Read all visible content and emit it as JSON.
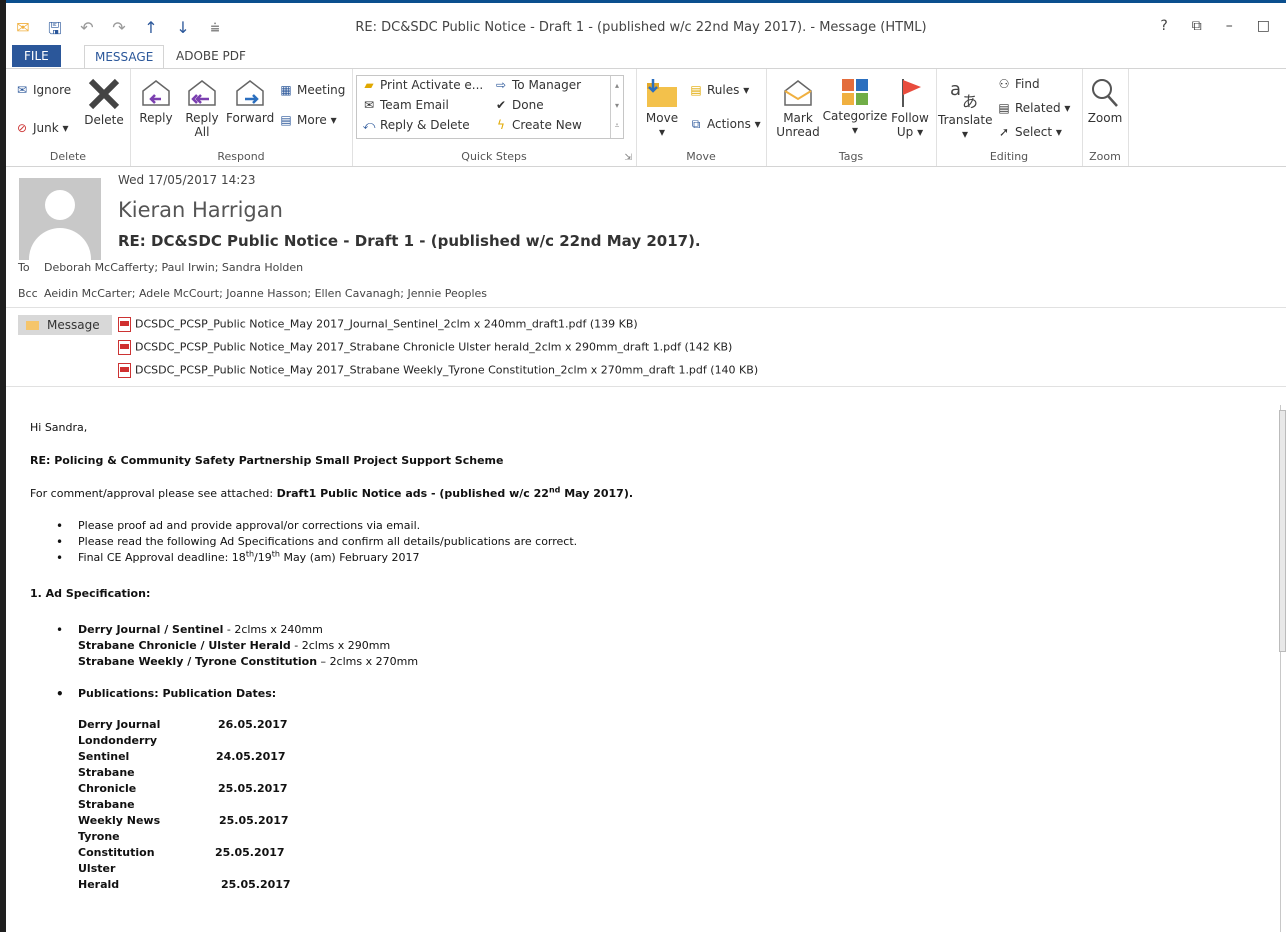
{
  "window": {
    "title": "RE: DC&SDC Public Notice - Draft 1 - (published w/c 22nd May 2017).  - Message (HTML)",
    "controls": [
      "?",
      "⧉",
      "–",
      "□"
    ]
  },
  "tabs": [
    "FILE",
    "MESSAGE",
    "ADOBE PDF"
  ],
  "ribbon": {
    "delete": {
      "label": "Delete",
      "ignore": "Ignore",
      "junk": "Junk",
      "delete_btn": "Delete"
    },
    "respond": {
      "label": "Respond",
      "reply": "Reply",
      "reply_all": "Reply All",
      "forward": "Forward",
      "meeting": "Meeting",
      "more": "More"
    },
    "quicksteps": {
      "label": "Quick Steps",
      "items": [
        "Print Activate e...",
        "Team Email",
        "Reply & Delete",
        "To Manager",
        "Done",
        "Create New"
      ]
    },
    "move": {
      "label": "Move",
      "move": "Move",
      "rules": "Rules",
      "actions": "Actions"
    },
    "tags": {
      "label": "Tags",
      "mark_unread": "Mark Unread",
      "categorize": "Categorize",
      "follow_up": "Follow Up"
    },
    "editing": {
      "label": "Editing",
      "translate": "Translate",
      "find": "Find",
      "related": "Related",
      "select": "Select"
    },
    "zoom": {
      "label": "Zoom",
      "zoom": "Zoom"
    }
  },
  "header": {
    "date": "Wed 17/05/2017 14:23",
    "sender": "Kieran Harrigan",
    "subject": "RE: DC&SDC Public Notice - Draft 1 - (published w/c 22nd May 2017).",
    "to_label": "To",
    "to": "Deborah McCafferty; Paul Irwin; Sandra Holden",
    "bcc_label": "Bcc",
    "bcc": "Aeidin McCarter; Adele McCourt; Joanne Hasson; Ellen Cavanagh; Jennie Peoples"
  },
  "attachments": {
    "message_tab": "Message",
    "files": [
      "DCSDC_PCSP_Public Notice_May 2017_Journal_Sentinel_2clm x 240mm_draft1.pdf (139 KB)",
      "DCSDC_PCSP_Public Notice_May 2017_Strabane Chronicle Ulster herald_2clm x 290mm_draft 1.pdf (142 KB)",
      "DCSDC_PCSP_Public Notice_May 2017_Strabane Weekly_Tyrone Constitution_2clm x 270mm_draft 1.pdf (140 KB)"
    ]
  },
  "email": {
    "greeting": "Hi Sandra,",
    "re_line": "RE: Policing & Community Safety Partnership Small Project Support Scheme",
    "comment_prefix": "For comment/approval please see attached: ",
    "comment_bold": "Draft1 Public Notice ads - (published w/c 22",
    "comment_sup": "nd",
    "comment_bold_end": " May 2017).",
    "bullets": [
      "Please proof ad and provide approval/or corrections via email.",
      "Please read the following Ad Specifications and confirm all details/publications are correct."
    ],
    "bullet3_a": "Final CE Approval deadline: 18",
    "bullet3_sup1": "th",
    "bullet3_b": "/19",
    "bullet3_sup2": "th",
    "bullet3_c": " May (am) February 2017",
    "spec_heading": "1. Ad Specification:",
    "specs": [
      {
        "name": "Derry Journal / Sentinel",
        "sep": " - ",
        "size": "2clms x 240mm"
      },
      {
        "name": "Strabane Chronicle / Ulster Herald",
        "sep": " - ",
        "size": "2clms x 290mm"
      },
      {
        "name": "Strabane Weekly / Tyrone Constitution",
        "sep": " – ",
        "size": "2clms x  270mm"
      }
    ],
    "pub_heading": "Publications: Publication Dates:",
    "publications": [
      {
        "name": "Derry Journal",
        "date": "26.05.2017"
      },
      {
        "name": "Londonderry",
        "date": ""
      },
      {
        "name": "Sentinel",
        "date": "24.05.2017"
      },
      {
        "name": "Strabane",
        "date": ""
      },
      {
        "name": "Chronicle",
        "date": "25.05.2017"
      },
      {
        "name": "Strabane",
        "date": ""
      },
      {
        "name": "Weekly News",
        "date": "25.05.2017"
      },
      {
        "name": "Tyrone",
        "date": ""
      },
      {
        "name": "Constitution",
        "date": "25.05.2017"
      },
      {
        "name": "Ulster",
        "date": ""
      },
      {
        "name": "Herald",
        "date": "25.05.2017"
      }
    ]
  }
}
